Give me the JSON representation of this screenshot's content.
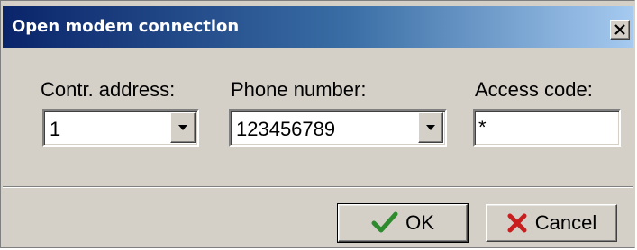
{
  "window": {
    "title": "Open modem connection",
    "close_icon": "close-icon"
  },
  "form": {
    "controller_address": {
      "label": "Contr. address:",
      "value": "1"
    },
    "phone_number": {
      "label": "Phone number:",
      "value": "123456789"
    },
    "access_code": {
      "label": "Access code:",
      "value": "*"
    }
  },
  "buttons": {
    "ok": {
      "label": "OK",
      "icon": "checkmark-icon",
      "icon_color": "#2e8b2e"
    },
    "cancel": {
      "label": "Cancel",
      "icon": "x-icon",
      "icon_color": "#c81e1e"
    }
  },
  "colors": {
    "titlebar_start": "#0a246a",
    "titlebar_end": "#a6caf0",
    "dialog_face": "#d4d0c8"
  }
}
